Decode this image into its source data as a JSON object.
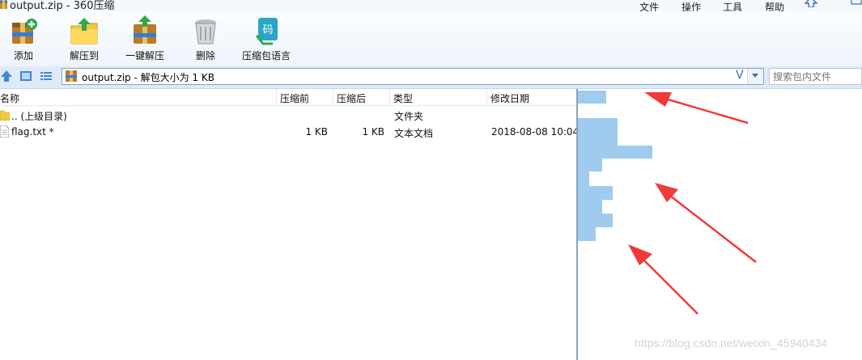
{
  "window": {
    "title": "output.zip - 360压缩",
    "menus": [
      "文件",
      "操作",
      "工具",
      "帮助"
    ]
  },
  "toolbar": {
    "items": [
      {
        "label": "添加",
        "icon": "add-icon"
      },
      {
        "label": "解压到",
        "icon": "extract-to-icon"
      },
      {
        "label": "一键解压",
        "icon": "one-click-extract-icon"
      },
      {
        "label": "删除",
        "icon": "delete-icon"
      },
      {
        "label": "压缩包语言",
        "icon": "archive-language-icon"
      }
    ]
  },
  "addressbar": {
    "path": "output.zip - 解包大小为 1 KB",
    "search_placeholder": "搜索包内文件"
  },
  "filelist": {
    "columns": [
      "名称",
      "压缩前",
      "压缩后",
      "类型",
      "修改日期"
    ],
    "rows": [
      {
        "name": ".. (上级目录)",
        "before": "",
        "after": "",
        "type": "文件夹",
        "date": "",
        "icon": "folder-icon"
      },
      {
        "name": "flag.txt *",
        "before": "1 KB",
        "after": "1 KB",
        "type": "文本文档",
        "date": "2018-08-08 10:04",
        "icon": "text-file-icon"
      }
    ]
  },
  "watermark": "https://blog.csdn.net/weixin_45940434",
  "colors": {
    "preview_bars": "#9ecbee",
    "arrow": "#f03a3a",
    "accent": "#3b6fb0"
  }
}
